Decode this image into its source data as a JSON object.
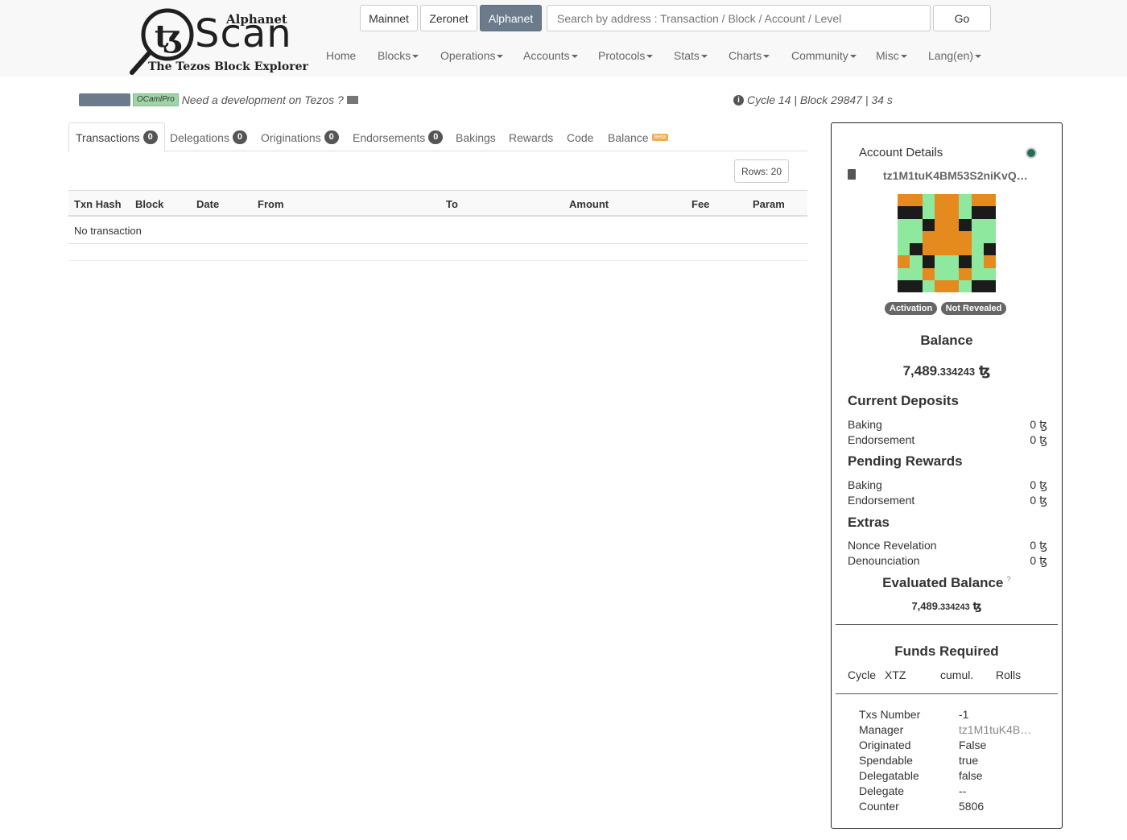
{
  "logo": {
    "network": "Alphanet",
    "brand": "Scan",
    "tagline": "The Tezos Block Explorer"
  },
  "networks": [
    {
      "label": "Mainnet",
      "active": false
    },
    {
      "label": "Zeronet",
      "active": false
    },
    {
      "label": "Alphanet",
      "active": true
    }
  ],
  "search": {
    "placeholder": "Search by address : Transaction / Block / Account / Level",
    "go_label": "Go"
  },
  "nav": [
    {
      "label": "Home",
      "dropdown": false
    },
    {
      "label": "Blocks",
      "dropdown": true
    },
    {
      "label": "Operations",
      "dropdown": true
    },
    {
      "label": "Accounts",
      "dropdown": true
    },
    {
      "label": "Protocols",
      "dropdown": true
    },
    {
      "label": "Stats",
      "dropdown": true
    },
    {
      "label": "Charts",
      "dropdown": true
    },
    {
      "label": "Community",
      "dropdown": true
    },
    {
      "label": "Misc",
      "dropdown": true
    },
    {
      "label": "Lang(en)",
      "dropdown": true
    }
  ],
  "promo": {
    "tag": "OCamlPro",
    "text": "Need a development on Tezos ?"
  },
  "status": {
    "text": "Cycle 14 | Block 29847 | 34 s"
  },
  "tabs": [
    {
      "label": "Transactions",
      "badge": "0",
      "active": true
    },
    {
      "label": "Delegations",
      "badge": "0"
    },
    {
      "label": "Originations",
      "badge": "0"
    },
    {
      "label": "Endorsements",
      "badge": "0"
    },
    {
      "label": "Bakings"
    },
    {
      "label": "Rewards"
    },
    {
      "label": "Code"
    },
    {
      "label": "Balance",
      "beta": "Beta"
    }
  ],
  "rows_label": "Rows: 20",
  "table": {
    "columns": [
      "Txn Hash",
      "Block",
      "Date",
      "From",
      "To",
      "Amount",
      "Fee",
      "Param"
    ],
    "empty_text": "No transaction"
  },
  "account": {
    "title": "Account Details",
    "address": "tz1M1tuK4BM53S2niKvQ…",
    "identicon_colors": {
      "o": "#e58a1f",
      "g": "#8ee89e",
      "k": "#1b1b1b"
    },
    "identicon": [
      "oogoogoo",
      "kkgoogkk",
      "ggkookgg",
      "ggoooogg",
      "gkoooogk",
      "ogkggkgo",
      "ggoggogg",
      "kkgoogkk"
    ],
    "tags": [
      "Activation",
      "Not Revealed"
    ],
    "balance_title": "Balance",
    "balance_int": "7,489",
    "balance_dec": ".334243",
    "currency": "ꜩ",
    "current_deposits": {
      "title": "Current Deposits",
      "rows": [
        {
          "label": "Baking",
          "value": "0 ꜩ"
        },
        {
          "label": "Endorsement",
          "value": "0 ꜩ"
        }
      ]
    },
    "pending_rewards": {
      "title": "Pending Rewards",
      "rows": [
        {
          "label": "Baking",
          "value": "0 ꜩ"
        },
        {
          "label": "Endorsement",
          "value": "0 ꜩ"
        }
      ]
    },
    "extras": {
      "title": "Extras",
      "rows": [
        {
          "label": "Nonce Revelation",
          "value": "0 ꜩ"
        },
        {
          "label": "Denounciation",
          "value": "0 ꜩ"
        }
      ]
    },
    "evaluated_title": "Evaluated Balance",
    "evaluated_help": "?",
    "evaluated_int": "7,489",
    "evaluated_dec": ".334243",
    "funds_title": "Funds Required",
    "funds_columns": [
      "Cycle",
      "XTZ",
      "cumul.",
      "Rolls"
    ],
    "info": [
      {
        "label": "Txs Number",
        "value": "-1"
      },
      {
        "label": "Manager",
        "value": "tz1M1tuK4B…",
        "muted": true
      },
      {
        "label": "Originated",
        "value": "False"
      },
      {
        "label": "Spendable",
        "value": "true"
      },
      {
        "label": "Delegatable",
        "value": "false"
      },
      {
        "label": "Delegate",
        "value": "--"
      },
      {
        "label": "Counter",
        "value": "5806"
      }
    ]
  }
}
